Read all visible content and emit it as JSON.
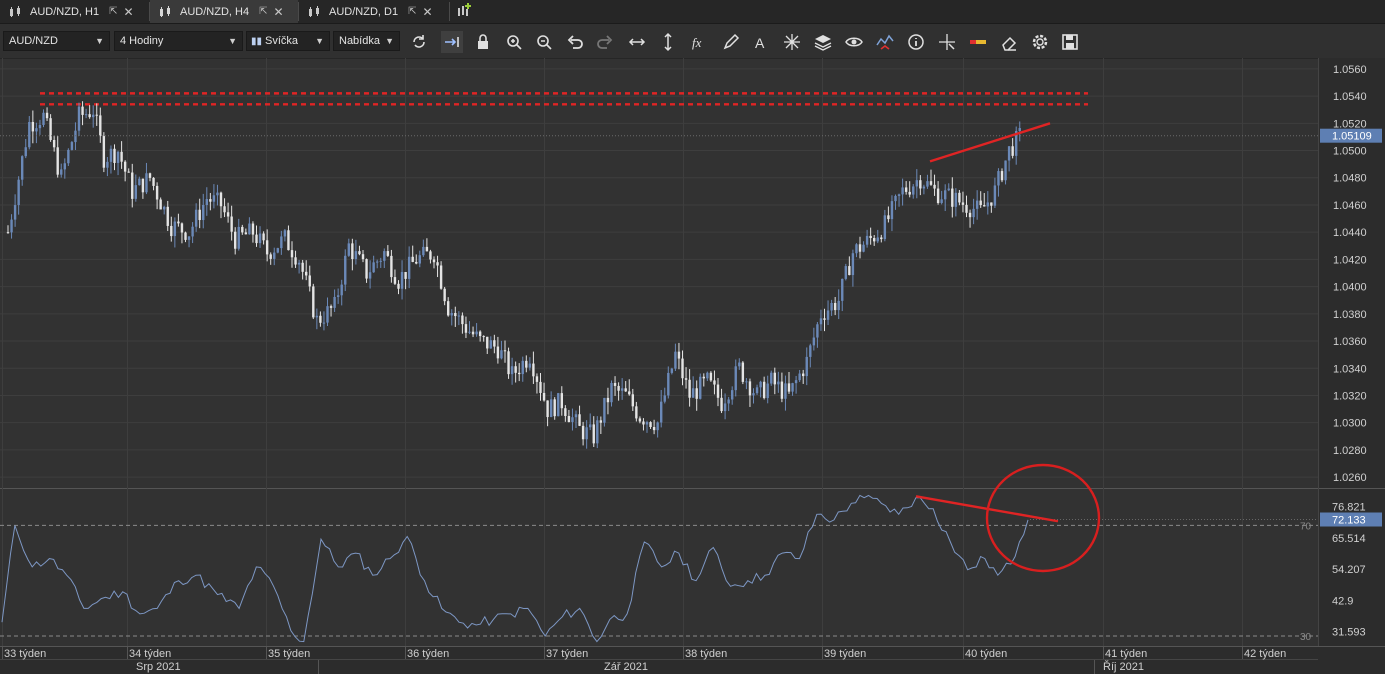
{
  "tabs": [
    {
      "label": "AUD/NZD, H1",
      "active": false
    },
    {
      "label": "AUD/NZD, H4",
      "active": true
    },
    {
      "label": "AUD/NZD, D1",
      "active": false
    }
  ],
  "toolbar": {
    "symbol": "AUD/NZD",
    "timeframe": "4 Hodiny",
    "chart_type": "Svíčka",
    "price_type": "Nabídka",
    "tools": [
      "refresh-icon",
      "auto-scroll-icon",
      "lock-icon",
      "zoom-in-icon",
      "zoom-out-icon",
      "undo-icon",
      "redo-icon",
      "horizontal-arrows-icon",
      "vertical-arrows-icon",
      "function-icon",
      "pencil-icon",
      "text-icon",
      "crosshair-icon",
      "layers-icon",
      "eye-icon",
      "alert-icon",
      "info-icon",
      "cursor-icon",
      "compare-icon",
      "eraser-icon",
      "settings-icon",
      "save-icon"
    ]
  },
  "colors": {
    "background": "#323232",
    "candle_up": "#6b89b8",
    "candle_down": "#e4e4e4",
    "annotation": "#e02424",
    "rsi_line": "#7d97c4",
    "grid": "#3e3e3e"
  },
  "chart_data": [
    {
      "type": "candlestick",
      "symbol": "AUD/NZD",
      "timeframe": "H4",
      "y_ticks": [
        "1.0560",
        "1.0540",
        "1.0520",
        "1.0500",
        "1.0480",
        "1.0460",
        "1.0440",
        "1.0420",
        "1.0400",
        "1.0380",
        "1.0360",
        "1.0340",
        "1.0320",
        "1.0300",
        "1.0280",
        "1.0260"
      ],
      "ylim": [
        1.0252,
        1.0568
      ],
      "current_price": "1.05109",
      "resistance_zone": [
        1.0534,
        1.0542
      ],
      "trendline": [
        [
          1.0492
        ],
        [
          1.052
        ]
      ],
      "close_path": [
        [
          0,
          1.044
        ],
        [
          6,
          1.052
        ],
        [
          10,
          1.0525
        ],
        [
          15,
          1.048
        ],
        [
          20,
          1.0525
        ],
        [
          24,
          1.053
        ],
        [
          27,
          1.0495
        ],
        [
          31,
          1.05
        ],
        [
          35,
          1.047
        ],
        [
          40,
          1.048
        ],
        [
          46,
          1.0445
        ],
        [
          51,
          1.044
        ],
        [
          56,
          1.0465
        ],
        [
          60,
          1.046
        ],
        [
          64,
          1.0435
        ],
        [
          69,
          1.044
        ],
        [
          73,
          1.0425
        ],
        [
          78,
          1.0435
        ],
        [
          82,
          1.042
        ],
        [
          87,
          1.0375
        ],
        [
          92,
          1.0385
        ],
        [
          96,
          1.043
        ],
        [
          101,
          1.041
        ],
        [
          106,
          1.0425
        ],
        [
          110,
          1.0405
        ],
        [
          115,
          1.042
        ],
        [
          120,
          1.0425
        ],
        [
          124,
          1.0385
        ],
        [
          129,
          1.037
        ],
        [
          133,
          1.036
        ],
        [
          138,
          1.0355
        ],
        [
          142,
          1.0335
        ],
        [
          147,
          1.035
        ],
        [
          152,
          1.031
        ],
        [
          156,
          1.0315
        ],
        [
          161,
          1.0295
        ],
        [
          165,
          1.029
        ],
        [
          170,
          1.0325
        ],
        [
          174,
          1.032
        ],
        [
          178,
          1.0305
        ],
        [
          183,
          1.03
        ],
        [
          188,
          1.035
        ],
        [
          192,
          1.032
        ],
        [
          197,
          1.033
        ],
        [
          201,
          1.0315
        ],
        [
          206,
          1.034
        ],
        [
          211,
          1.032
        ],
        [
          215,
          1.033
        ],
        [
          220,
          1.032
        ],
        [
          225,
          1.0345
        ],
        [
          229,
          1.038
        ],
        [
          234,
          1.039
        ],
        [
          238,
          1.0425
        ],
        [
          243,
          1.0435
        ],
        [
          247,
          1.0445
        ],
        [
          252,
          1.047
        ],
        [
          257,
          1.048
        ],
        [
          261,
          1.047
        ],
        [
          266,
          1.0465
        ],
        [
          270,
          1.046
        ],
        [
          274,
          1.0455
        ],
        [
          278,
          1.047
        ],
        [
          282,
          1.05
        ],
        [
          285,
          1.051
        ]
      ],
      "n_candles": 286
    },
    {
      "type": "line",
      "name": "RSI",
      "levels": [
        70,
        30
      ],
      "y_ticks": [
        "76.821",
        "65.514",
        "54.207",
        "42.9",
        "31.593"
      ],
      "ylim": [
        26.4,
        82.8
      ],
      "current_value": "72.133",
      "trendline": [
        [
          80.5
        ],
        [
          71.5
        ]
      ],
      "values_path": [
        [
          0,
          35
        ],
        [
          3,
          70
        ],
        [
          7,
          55
        ],
        [
          11,
          58
        ],
        [
          15,
          52
        ],
        [
          19,
          40
        ],
        [
          24,
          44
        ],
        [
          28,
          46
        ],
        [
          32,
          38
        ],
        [
          36,
          40
        ],
        [
          41,
          50
        ],
        [
          45,
          52
        ],
        [
          50,
          45
        ],
        [
          55,
          40
        ],
        [
          59,
          55
        ],
        [
          63,
          48
        ],
        [
          67,
          32
        ],
        [
          70,
          28
        ],
        [
          74,
          65
        ],
        [
          78,
          55
        ],
        [
          82,
          60
        ],
        [
          86,
          52
        ],
        [
          90,
          58
        ],
        [
          94,
          66
        ],
        [
          98,
          50
        ],
        [
          102,
          40
        ],
        [
          106,
          35
        ],
        [
          110,
          34
        ],
        [
          114,
          36
        ],
        [
          118,
          38
        ],
        [
          122,
          40
        ],
        [
          126,
          30
        ],
        [
          130,
          37
        ],
        [
          134,
          40
        ],
        [
          138,
          28
        ],
        [
          141,
          36
        ],
        [
          145,
          38
        ],
        [
          149,
          64
        ],
        [
          153,
          55
        ],
        [
          157,
          60
        ],
        [
          161,
          50
        ],
        [
          165,
          62
        ],
        [
          169,
          48
        ],
        [
          173,
          50
        ],
        [
          177,
          52
        ],
        [
          181,
          60
        ],
        [
          185,
          58
        ],
        [
          189,
          74
        ],
        [
          193,
          72
        ],
        [
          197,
          78
        ],
        [
          200,
          80
        ],
        [
          204,
          78
        ],
        [
          208,
          74
        ],
        [
          212,
          80
        ],
        [
          216,
          76
        ],
        [
          220,
          64
        ],
        [
          224,
          54
        ],
        [
          228,
          58
        ],
        [
          231,
          52
        ],
        [
          234,
          56
        ],
        [
          236,
          64
        ],
        [
          238,
          72
        ]
      ]
    }
  ],
  "x_axis": {
    "weeks": [
      "33 týden",
      "34 týden",
      "35 týden",
      "36 týden",
      "37 týden",
      "38 týden",
      "39 týden",
      "40 týden",
      "41 týden",
      "42 týden"
    ],
    "months": [
      "Srp 2021",
      "Zář 2021",
      "Říj 2021"
    ]
  },
  "rsi_level_labels": [
    "70",
    "30"
  ]
}
